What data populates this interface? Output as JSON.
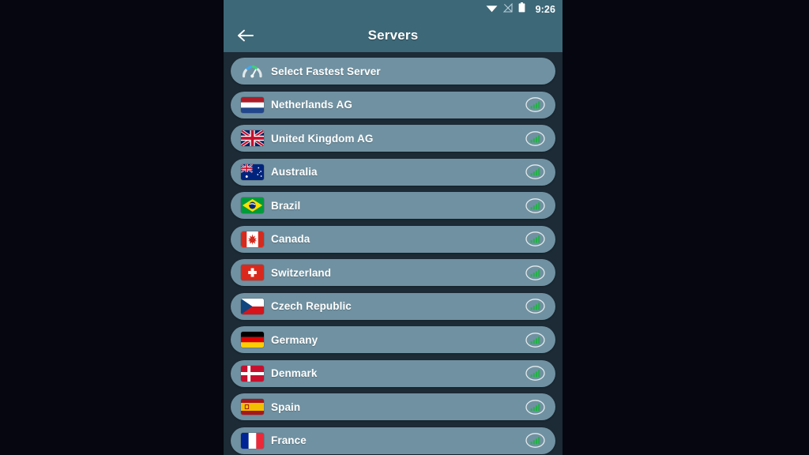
{
  "statusbar": {
    "time": "9:26",
    "icons": [
      "wifi-icon",
      "no-signal-icon",
      "battery-icon"
    ]
  },
  "appbar": {
    "title": "Servers",
    "back_icon": "back-arrow-icon"
  },
  "list": {
    "items": [
      {
        "label": "Select Fastest Server",
        "icon": "speedometer-icon",
        "has_signal": false
      },
      {
        "label": "Netherlands AG",
        "icon": "flag-netherlands",
        "has_signal": true
      },
      {
        "label": "United Kingdom AG",
        "icon": "flag-united-kingdom",
        "has_signal": true
      },
      {
        "label": "Australia",
        "icon": "flag-australia",
        "has_signal": true
      },
      {
        "label": "Brazil",
        "icon": "flag-brazil",
        "has_signal": true
      },
      {
        "label": "Canada",
        "icon": "flag-canada",
        "has_signal": true
      },
      {
        "label": "Switzerland",
        "icon": "flag-switzerland",
        "has_signal": true
      },
      {
        "label": "Czech Republic",
        "icon": "flag-czech-republic",
        "has_signal": true
      },
      {
        "label": "Germany",
        "icon": "flag-germany",
        "has_signal": true
      },
      {
        "label": "Denmark",
        "icon": "flag-denmark",
        "has_signal": true
      },
      {
        "label": "Spain",
        "icon": "flag-spain",
        "has_signal": true
      },
      {
        "label": "France",
        "icon": "flag-france",
        "has_signal": true
      }
    ]
  },
  "colors": {
    "page_background": "#05060f",
    "phone_background": "#1c2b36",
    "appbar": "#3d6878",
    "row": "#7091a1",
    "text": "#ffffff",
    "signal_green": "#24b14a"
  }
}
